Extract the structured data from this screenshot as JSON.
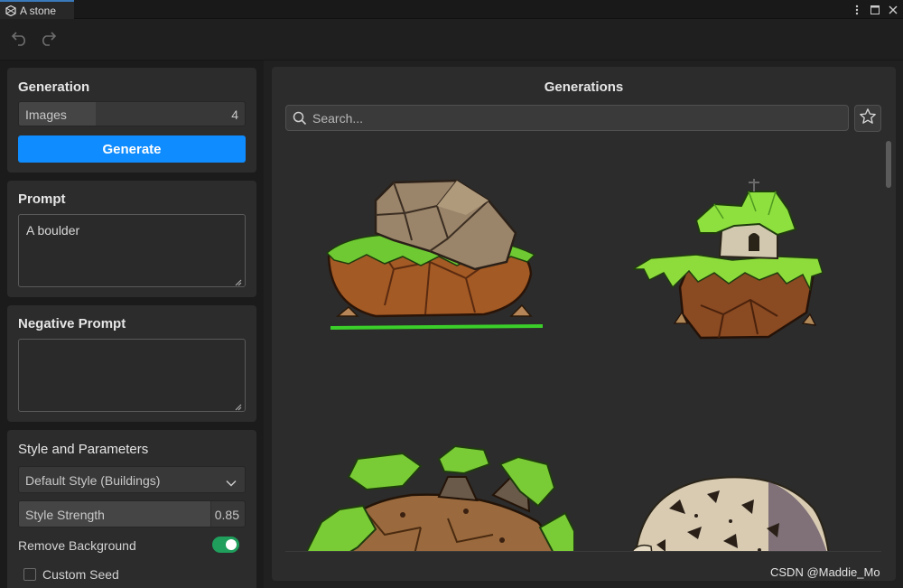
{
  "window": {
    "tab_title": "A stone",
    "tab_icon": "unity-logo-icon",
    "controls": [
      "more-vert-icon",
      "maximize-icon",
      "close-icon"
    ]
  },
  "toolbar": {
    "undo_icon": "undo-icon",
    "redo_icon": "redo-icon"
  },
  "generation": {
    "title": "Generation",
    "images_label": "Images",
    "images_value": "4",
    "images_fill_fraction": 0.34,
    "generate_label": "Generate"
  },
  "prompt": {
    "title": "Prompt",
    "value": "A boulder"
  },
  "negative_prompt": {
    "title": "Negative Prompt",
    "value": ""
  },
  "style": {
    "title": "Style and Parameters",
    "selected_style": "Default Style (Buildings)",
    "strength_label": "Style Strength",
    "strength_value": "0.85",
    "strength_fraction": 0.85,
    "remove_bg_label": "Remove Background",
    "remove_bg_on": true,
    "custom_seed_label": "Custom Seed",
    "custom_seed_checked": false
  },
  "generations": {
    "title": "Generations",
    "search_placeholder": "Search...",
    "favorite_icon": "star-outline-icon",
    "images": [
      "mushroom-rock-island-image",
      "hut-on-floating-island-image",
      "mossy-rock-pile-image",
      "spotted-boulder-image"
    ]
  },
  "watermark": "CSDN @Maddie_Mo",
  "colors": {
    "accent": "#0f8cff",
    "toggle_on": "#1f9e5c",
    "panel": "#2c2c2c",
    "background": "#1b1b1b"
  }
}
